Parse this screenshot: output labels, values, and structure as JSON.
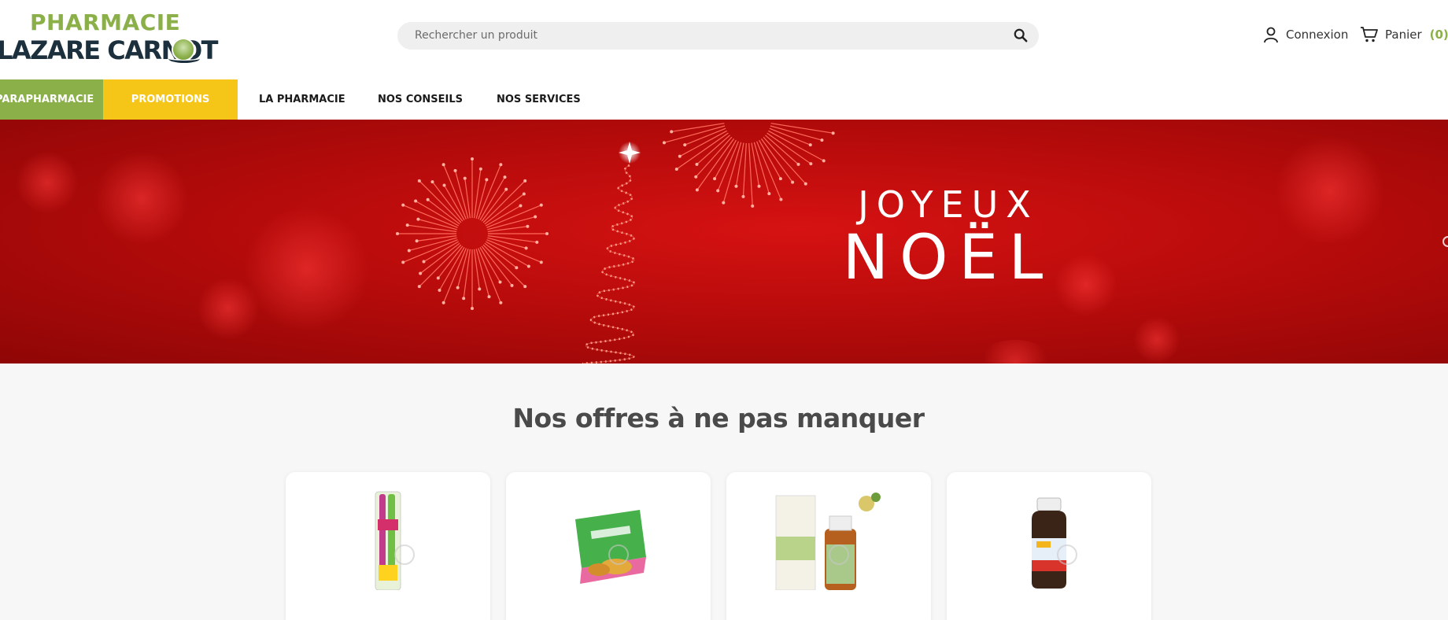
{
  "header": {
    "logo_line1": "PHARMACIE",
    "logo_line2": "LAZARE CARNOT",
    "search_placeholder": "Rechercher un produit",
    "search_icon": "search-icon",
    "account_label": "Connexion",
    "account_icon": "user-icon",
    "cart_label": "Panier",
    "cart_count": "(0)",
    "cart_icon": "cart-icon"
  },
  "nav": {
    "items": [
      {
        "label": "PARAPHARMACIE",
        "color": "#8bb04a"
      },
      {
        "label": "PROMOTIONS",
        "color": "#f5c518"
      },
      {
        "label": "LA PHARMACIE"
      },
      {
        "label": "NOS CONSEILS"
      },
      {
        "label": "NOS SERVICES"
      }
    ]
  },
  "banner": {
    "line1": "JOYEUX",
    "line2": "NOËL",
    "background_color": "#b80b0b"
  },
  "offers": {
    "title": "Nos offres à ne pas manquer",
    "products": [
      {
        "name": "toothbrush-product"
      },
      {
        "name": "sleep-supplement-box-product"
      },
      {
        "name": "pranarom-tea-tree-oil-product"
      },
      {
        "name": "syrup-bottle-product"
      }
    ]
  },
  "colors": {
    "brand_green": "#8bb04a",
    "brand_yellow": "#f5c518",
    "brand_dark": "#1b2f3c"
  }
}
